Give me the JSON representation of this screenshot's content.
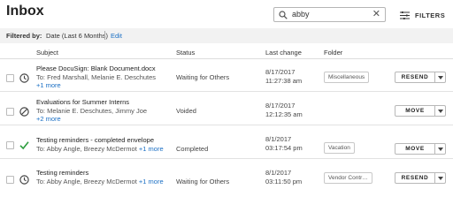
{
  "page": {
    "title": "Inbox"
  },
  "search": {
    "value": "abby",
    "clear_glyph": "✕"
  },
  "filters": {
    "label": "FILTERS",
    "icon": "sliders-icon"
  },
  "filter_bar": {
    "label": "Filtered by:",
    "value": "Date (Last 6 Months)",
    "edit_label": "Edit"
  },
  "columns": {
    "subject": "Subject",
    "status": "Status",
    "last_change": "Last change",
    "folder": "Folder"
  },
  "colors": {
    "link": "#1a6fc4",
    "completed": "#2e9e3f"
  },
  "rows": [
    {
      "status_icon": "clock-icon",
      "subject": "Please DocuSign: Blank Document.docx",
      "to": "To: Fred Marshall, Melanie E. Deschutes",
      "more": "+1 more",
      "status": "Waiting for Others",
      "date": "8/17/2017",
      "time": "11:27:38 am",
      "folder": "Miscellaneous",
      "action": "RESEND"
    },
    {
      "status_icon": "voided-icon",
      "subject": "Evaluations for Summer Interns",
      "to": "To: Melanie E. Deschutes, Jimmy Joe",
      "more": "+2 more",
      "status": "Voided",
      "date": "8/17/2017",
      "time": "12:12:35 am",
      "folder": "",
      "action": "MOVE"
    },
    {
      "status_icon": "checkmark-icon",
      "subject": "Testing reminders - completed envelope",
      "to": "To: Abby Angle, Breezy McDermot",
      "more": "+1 more",
      "status": "Completed",
      "date": "8/1/2017",
      "time": "03:17:54 pm",
      "folder": "Vacation",
      "action": "MOVE"
    },
    {
      "status_icon": "clock-icon",
      "subject": "Testing reminders",
      "to": "To: Abby Angle, Breezy McDermot",
      "more": "+1 more",
      "status": "Waiting for Others",
      "date": "8/1/2017",
      "time": "03:11:50 pm",
      "folder": "Vendor Contr…",
      "action": "RESEND"
    }
  ]
}
